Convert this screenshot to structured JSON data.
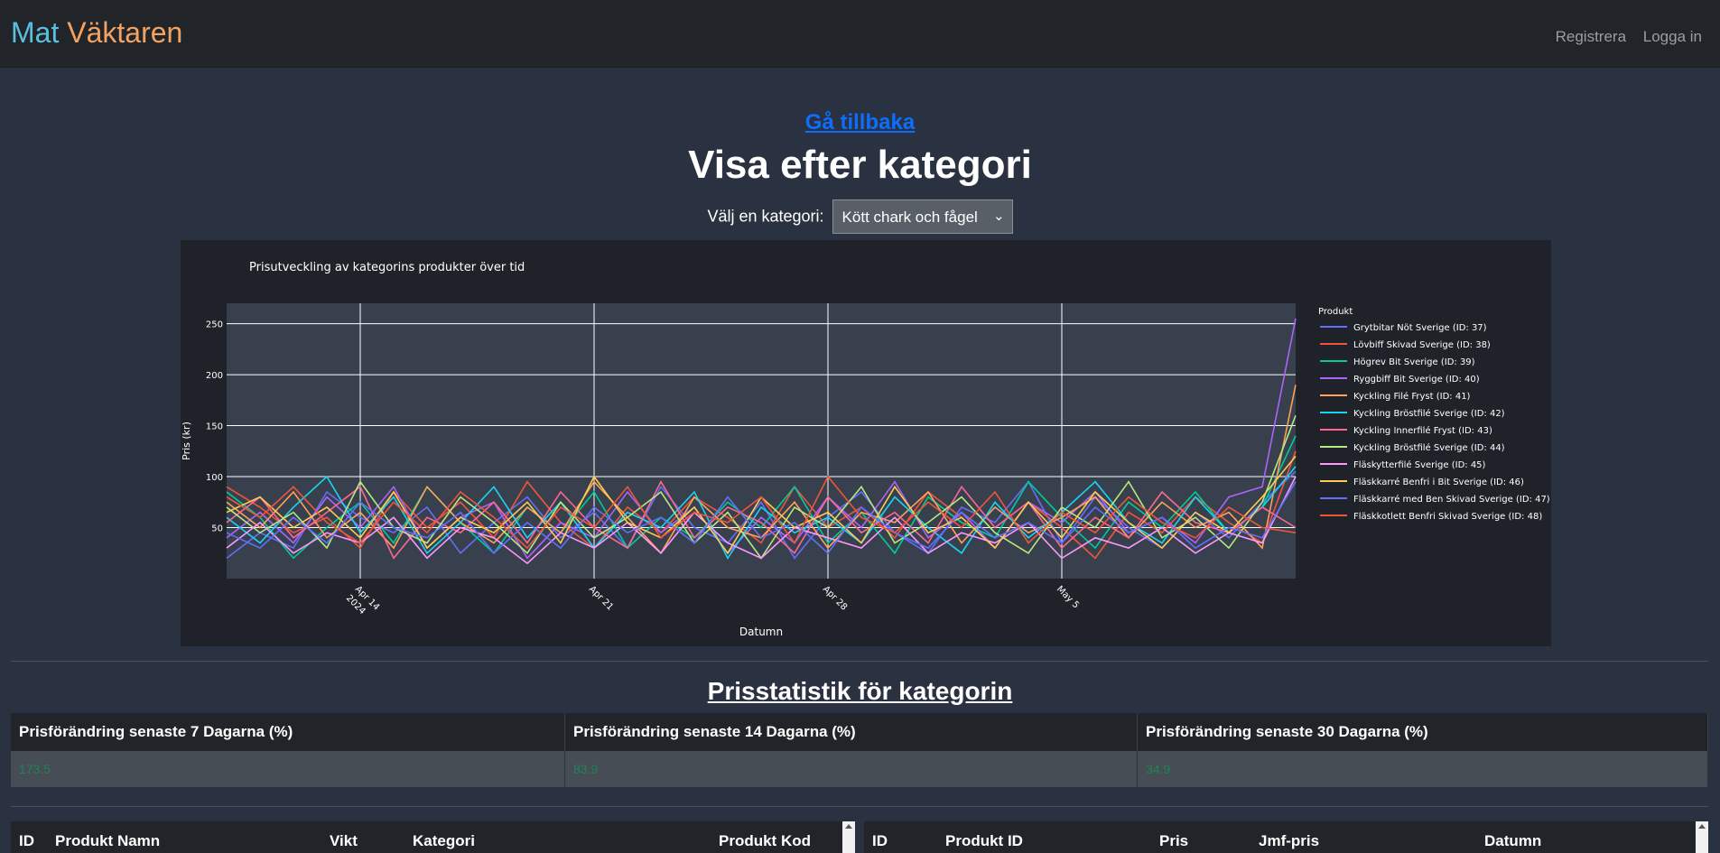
{
  "nav": {
    "brand_part1": "Mat",
    "brand_part2": "Väktaren",
    "register": "Registrera",
    "login": "Logga in"
  },
  "page": {
    "back_link": "Gå tillbaka",
    "title": "Visa efter kategori",
    "category_label": "Välj en kategori:",
    "category_selected": "Kött chark och fågel"
  },
  "chart_data": {
    "type": "line",
    "title": "Prisutveckling av kategorins produkter över tid",
    "xlabel": "Datumn",
    "ylabel": "Pris (kr)",
    "ylim": [
      0,
      270
    ],
    "yticks": [
      50,
      100,
      150,
      200,
      250
    ],
    "xtick_labels": [
      "Apr 14\n2024",
      "Apr 21",
      "Apr 28",
      "May 5"
    ],
    "x_start": "2024-04-10",
    "x_end": "2024-05-12",
    "legend_title": "Produkt",
    "legend_position": "right",
    "series": [
      {
        "name": "Grytbitar Nöt Sverige (ID: 37)",
        "color": "#636efa",
        "values": [
          20,
          45,
          30,
          85,
          60,
          45,
          70,
          25,
          55,
          80,
          40,
          65,
          30,
          90,
          50,
          35,
          75,
          20,
          60,
          85,
          45,
          25,
          70,
          55,
          95,
          35,
          80,
          50,
          30,
          65,
          40,
          75,
          105
        ]
      },
      {
        "name": "Lövbiff Skivad Sverige (ID: 38)",
        "color": "#ef553b",
        "values": [
          90,
          70,
          45,
          60,
          30,
          85,
          50,
          75,
          40,
          95,
          55,
          30,
          70,
          45,
          80,
          60,
          35,
          90,
          50,
          70,
          40,
          85,
          60,
          30,
          75,
          50,
          20,
          65,
          45,
          80,
          55,
          35,
          125
        ]
      },
      {
        "name": "Högrev Bit Sverige (ID: 39)",
        "color": "#00cc96",
        "values": [
          85,
          60,
          20,
          50,
          75,
          35,
          90,
          55,
          25,
          70,
          45,
          85,
          30,
          60,
          40,
          75,
          50,
          90,
          35,
          65,
          25,
          80,
          55,
          40,
          95,
          60,
          30,
          75,
          50,
          85,
          45,
          70,
          140
        ]
      },
      {
        "name": "Ryggbiff Bit Sverige (ID: 40)",
        "color": "#ab63fa",
        "values": [
          40,
          65,
          35,
          80,
          50,
          90,
          30,
          60,
          75,
          20,
          55,
          40,
          85,
          45,
          70,
          25,
          60,
          35,
          80,
          50,
          95,
          40,
          65,
          30,
          75,
          55,
          85,
          45,
          60,
          35,
          80,
          90,
          255
        ]
      },
      {
        "name": "Kyckling Filé Fryst (ID: 41)",
        "color": "#ffa15a",
        "values": [
          75,
          50,
          85,
          40,
          65,
          30,
          90,
          55,
          35,
          70,
          45,
          95,
          60,
          25,
          80,
          50,
          40,
          75,
          30,
          65,
          55,
          85,
          35,
          70,
          45,
          60,
          80,
          40,
          75,
          50,
          65,
          30,
          190
        ]
      },
      {
        "name": "Kyckling Bröstfilé Sverige (ID: 42)",
        "color": "#19d3f3",
        "values": [
          60,
          35,
          70,
          100,
          45,
          80,
          25,
          55,
          90,
          40,
          75,
          30,
          65,
          50,
          85,
          20,
          70,
          45,
          60,
          35,
          80,
          50,
          25,
          75,
          40,
          65,
          95,
          55,
          35,
          80,
          45,
          70,
          110
        ]
      },
      {
        "name": "Kyckling Innerfilé Fryst (ID: 43)",
        "color": "#ff6692",
        "values": [
          55,
          80,
          40,
          65,
          90,
          20,
          60,
          45,
          75,
          35,
          85,
          50,
          30,
          95,
          40,
          70,
          55,
          25,
          80,
          45,
          65,
          35,
          90,
          50,
          75,
          30,
          60,
          40,
          85,
          55,
          45,
          70,
          50
        ]
      },
      {
        "name": "Kyckling Bröstfilé Sverige (ID: 44)",
        "color": "#b6e880",
        "values": [
          70,
          45,
          65,
          30,
          95,
          50,
          35,
          80,
          55,
          25,
          75,
          40,
          60,
          85,
          35,
          65,
          20,
          70,
          50,
          90,
          35,
          55,
          80,
          45,
          25,
          70,
          50,
          95,
          40,
          60,
          30,
          75,
          160
        ]
      },
      {
        "name": "Fläskytterfilé Sverige (ID: 45)",
        "color": "#ff97ff",
        "values": [
          30,
          55,
          25,
          45,
          35,
          60,
          20,
          50,
          40,
          15,
          45,
          30,
          55,
          25,
          65,
          35,
          20,
          50,
          40,
          30,
          60,
          25,
          45,
          35,
          55,
          20,
          40,
          30,
          50,
          25,
          45,
          35,
          100
        ]
      },
      {
        "name": "Fläskkarré Benfri i Bit Sverige (ID: 46)",
        "color": "#fecb52",
        "values": [
          65,
          80,
          50,
          70,
          40,
          85,
          30,
          60,
          45,
          75,
          35,
          100,
          55,
          40,
          70,
          25,
          80,
          50,
          65,
          35,
          90,
          45,
          60,
          30,
          75,
          40,
          85,
          55,
          30,
          65,
          45,
          80,
          120
        ]
      },
      {
        "name": "Fläskkarré med Ben Skivad Sverige (ID: 47)",
        "color": "#636efa",
        "values": [
          45,
          30,
          60,
          35,
          75,
          50,
          40,
          65,
          25,
          55,
          30,
          70,
          45,
          60,
          35,
          80,
          40,
          55,
          25,
          70,
          45,
          30,
          65,
          40,
          55,
          35,
          70,
          45,
          60,
          30,
          50,
          40,
          95
        ]
      },
      {
        "name": "Fläskkotlett Benfri Skivad Sverige (ID: 48)",
        "color": "#ef553b",
        "values": [
          80,
          60,
          90,
          55,
          35,
          75,
          45,
          85,
          60,
          30,
          70,
          50,
          90,
          40,
          65,
          55,
          80,
          35,
          100,
          60,
          45,
          75,
          50,
          85,
          35,
          65,
          45,
          80,
          55,
          40,
          70,
          50,
          45
        ]
      }
    ]
  },
  "stats": {
    "title": "Prisstatistik för kategorin",
    "headers": [
      "Prisförändring senaste 7 Dagarna (%)",
      "Prisförändring senaste 14 Dagarna (%)",
      "Prisförändring senaste 30 Dagarna (%)"
    ],
    "values": [
      "173.5",
      "83.9",
      "34.9"
    ]
  },
  "table_left": {
    "headers": [
      "ID",
      "Produkt Namn",
      "Vikt",
      "Kategori",
      "Produkt Kod"
    ]
  },
  "table_right": {
    "headers": [
      "ID",
      "Produkt ID",
      "Pris",
      "Jmf-pris",
      "Datumn"
    ]
  }
}
